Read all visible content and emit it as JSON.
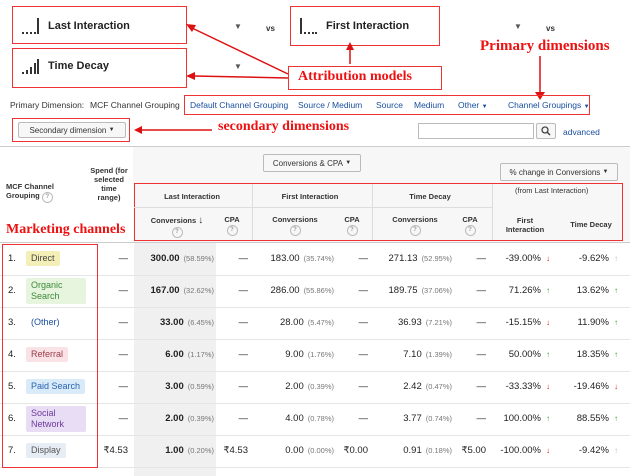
{
  "models": [
    {
      "name": "Last Interaction"
    },
    {
      "name": "First Interaction"
    },
    {
      "name": "Time Decay"
    }
  ],
  "vs": "vs",
  "annotations": {
    "primary_dimensions": "Primary dimensions",
    "attribution_models": "Attribution models",
    "secondary_dimensions": "secondary dimensions",
    "marketing_channels": "Marketing channels"
  },
  "primary_dimension_label": "Primary Dimension:",
  "primary_dimension_value": "MCF Channel Grouping",
  "dimension_tabs": [
    "Default Channel Grouping",
    "Source / Medium",
    "Source",
    "Medium",
    "Other",
    "Channel Groupings"
  ],
  "secondary_dimension_button": "Secondary dimension",
  "search": {
    "placeholder": "",
    "advanced": "advanced"
  },
  "metric_selector": "Conversions & CPA",
  "change_selector": "% change in Conversions",
  "change_subtitle": "(from Last Interaction)",
  "columns": {
    "channel": "MCF Channel Grouping",
    "spend": "Spend (for selected time range)",
    "group1": "Last Interaction",
    "group2": "First Interaction",
    "group3": "Time Decay",
    "conversions": "Conversions",
    "cpa": "CPA",
    "change1": "First Interaction",
    "change2": "Time Decay"
  },
  "rows": [
    {
      "idx": "1.",
      "channel": "Direct",
      "color": "#f3efb6",
      "tcolor": "#444",
      "spend": "—",
      "c1": "300.00",
      "p1": "(58.59%)",
      "cpa1": "—",
      "c2": "183.00",
      "p2": "(35.74%)",
      "cpa2": "—",
      "c3": "271.13",
      "p3": "(52.95%)",
      "cpa3": "—",
      "ch1": "-39.00%",
      "ch1dir": "down",
      "ch2": "-9.62%",
      "ch2dir": "flat"
    },
    {
      "idx": "2.",
      "channel": "Organic Search",
      "color": "#e7f4de",
      "tcolor": "#3c8a3c",
      "spend": "—",
      "c1": "167.00",
      "p1": "(32.62%)",
      "cpa1": "—",
      "c2": "286.00",
      "p2": "(55.86%)",
      "cpa2": "—",
      "c3": "189.75",
      "p3": "(37.06%)",
      "cpa3": "—",
      "ch1": "71.26%",
      "ch1dir": "up",
      "ch2": "13.62%",
      "ch2dir": "up"
    },
    {
      "idx": "3.",
      "channel": "(Other)",
      "color": "#ffffff",
      "tcolor": "#1a4fa0",
      "spend": "—",
      "c1": "33.00",
      "p1": "(6.45%)",
      "cpa1": "—",
      "c2": "28.00",
      "p2": "(5.47%)",
      "cpa2": "—",
      "c3": "36.93",
      "p3": "(7.21%)",
      "cpa3": "—",
      "ch1": "-15.15%",
      "ch1dir": "down",
      "ch2": "11.90%",
      "ch2dir": "up"
    },
    {
      "idx": "4.",
      "channel": "Referral",
      "color": "#f9e3e6",
      "tcolor": "#9b3a4a",
      "spend": "—",
      "c1": "6.00",
      "p1": "(1.17%)",
      "cpa1": "—",
      "c2": "9.00",
      "p2": "(1.76%)",
      "cpa2": "—",
      "c3": "7.10",
      "p3": "(1.39%)",
      "cpa3": "—",
      "ch1": "50.00%",
      "ch1dir": "up",
      "ch2": "18.35%",
      "ch2dir": "up"
    },
    {
      "idx": "5.",
      "channel": "Paid Search",
      "color": "#d9eaf9",
      "tcolor": "#2a63b0",
      "spend": "—",
      "c1": "3.00",
      "p1": "(0.59%)",
      "cpa1": "—",
      "c2": "2.00",
      "p2": "(0.39%)",
      "cpa2": "—",
      "c3": "2.42",
      "p3": "(0.47%)",
      "cpa3": "—",
      "ch1": "-33.33%",
      "ch1dir": "down",
      "ch2": "-19.46%",
      "ch2dir": "down"
    },
    {
      "idx": "6.",
      "channel": "Social Network",
      "color": "#e9dcf5",
      "tcolor": "#6b3b9a",
      "spend": "—",
      "c1": "2.00",
      "p1": "(0.39%)",
      "cpa1": "—",
      "c2": "4.00",
      "p2": "(0.78%)",
      "cpa2": "—",
      "c3": "3.77",
      "p3": "(0.74%)",
      "cpa3": "—",
      "ch1": "100.00%",
      "ch1dir": "up",
      "ch2": "88.55%",
      "ch2dir": "up"
    },
    {
      "idx": "7.",
      "channel": "Display",
      "color": "#e6edf5",
      "tcolor": "#555",
      "spend": "₹4.53",
      "c1": "1.00",
      "p1": "(0.20%)",
      "cpa1": "₹4.53",
      "c2": "0.00",
      "p2": "(0.00%)",
      "cpa2": "₹0.00",
      "c3": "0.91",
      "p3": "(0.18%)",
      "cpa3": "₹5.00",
      "ch1": "-100.00%",
      "ch1dir": "down",
      "ch2": "-9.42%",
      "ch2dir": "flat"
    }
  ]
}
